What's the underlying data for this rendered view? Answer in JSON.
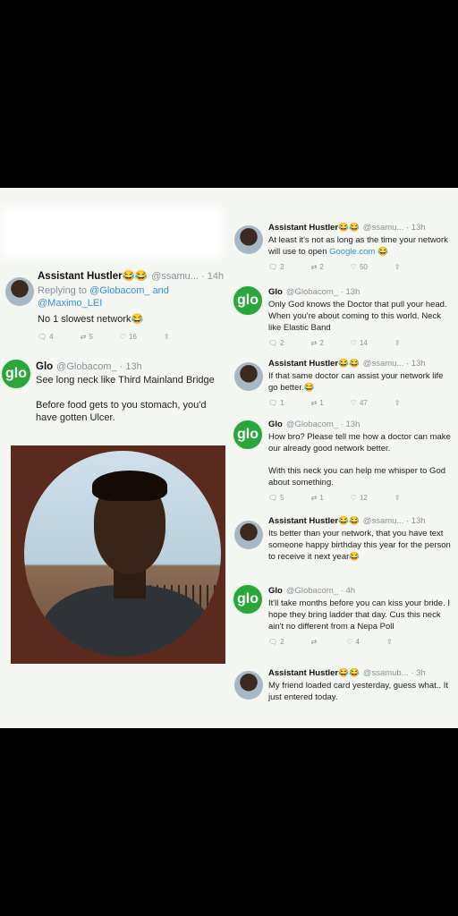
{
  "tweets": [
    {
      "id": "t1",
      "name": "Assistant Hustler😂😂",
      "handle": "@ssamu... · 14h",
      "reply_prefix": "Replying to ",
      "reply_handles": "@Globacom_ and",
      "reply_handles2": "@Maximo_LEI",
      "text": "No 1 slowest network😂",
      "counts": {
        "reply": "4",
        "retweet": "5",
        "like": "16"
      }
    },
    {
      "id": "t2",
      "name": "Glo",
      "handle": "@Globacom_ · 13h",
      "text1": "See long neck like Third Mainland Bridge",
      "text2": "Before food gets to you stomach, you'd have gotten Ulcer.",
      "avatar_label": "glo"
    },
    {
      "id": "t3",
      "name": "Assistant Hustler😂😂",
      "handle": "@ssamu... · 13h",
      "text_pre": "At least it's not as long as the time your network will use to open ",
      "text_link": "Google.com",
      "text_post": " 😂",
      "counts": {
        "reply": "2",
        "retweet": "2",
        "like": "50"
      }
    },
    {
      "id": "t4",
      "name": "Glo",
      "handle": "@Globacom_ · 13h",
      "text": "Only God knows the Doctor that pull your head. When you're about coming to this world. Neck like Elastic Band",
      "counts": {
        "reply": "2",
        "retweet": "2",
        "like": "14"
      },
      "avatar_label": "glo"
    },
    {
      "id": "t5",
      "name": "Assistant Hustler😂😂",
      "handle": "@ssamu... · 13h",
      "text": "If that same doctor can assist your network life go better.😂",
      "counts": {
        "reply": "1",
        "retweet": "1",
        "like": "47"
      }
    },
    {
      "id": "t6",
      "name": "Glo",
      "handle": "@Globacom_ · 13h",
      "text1": "How bro? Please tell me how a doctor can make our already good network better.",
      "text2": "With this neck you can help me whisper to God about something.",
      "counts": {
        "reply": "5",
        "retweet": "1",
        "like": "12"
      },
      "avatar_label": "glo"
    },
    {
      "id": "t7",
      "name": "Assistant Hustler😂😂",
      "handle": "@ssamu... · 13h",
      "text": "Its better than your network, that you have text someone happy birthday this year for the person to receive it next year😂"
    },
    {
      "id": "t8",
      "name": "Glo",
      "handle": "@Globacom_ · 4h",
      "text": "It'll take months before you can kiss your bride. I hope they bring ladder that day. Cus this neck ain't no different from a Nepa Poll",
      "counts": {
        "reply": "2",
        "retweet": "",
        "like": "4"
      },
      "avatar_label": "glo"
    },
    {
      "id": "t9",
      "name": "Assistant Hustler😂😂",
      "handle": "@ssamub... · 3h",
      "text": "My friend loaded card yesterday, guess what.. It just entered today."
    }
  ]
}
